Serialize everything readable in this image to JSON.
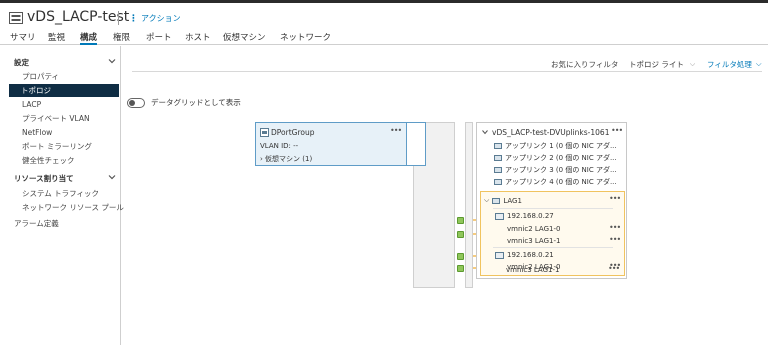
{
  "header": {
    "title": "vDS_LACP-test",
    "actions_label": "アクション",
    "icon": "distributed-switch-icon"
  },
  "tabs": [
    {
      "label": "サマリ",
      "active": false
    },
    {
      "label": "監視",
      "active": false
    },
    {
      "label": "構成",
      "active": true
    },
    {
      "label": "権限",
      "active": false
    },
    {
      "label": "ポート",
      "active": false
    },
    {
      "label": "ホスト",
      "active": false
    },
    {
      "label": "仮想マシン",
      "active": false
    },
    {
      "label": "ネットワーク",
      "active": false
    }
  ],
  "sidebar": {
    "section_settings": "設定",
    "settings_items": [
      {
        "label": "プロパティ",
        "active": false
      },
      {
        "label": "トポロジ",
        "active": true
      },
      {
        "label": "LACP",
        "active": false
      },
      {
        "label": "プライベート VLAN",
        "active": false
      },
      {
        "label": "NetFlow",
        "active": false
      },
      {
        "label": "ポート ミラーリング",
        "active": false
      },
      {
        "label": "健全性チェック",
        "active": false
      }
    ],
    "section_resources": "リソース割り当て",
    "resource_items": [
      {
        "label": "システム トラフィック"
      },
      {
        "label": "ネットワーク リソース プール"
      }
    ],
    "alarm_definitions": "アラーム定義"
  },
  "toolbar": {
    "favorite_filter": "お気に入りフィルタ",
    "view_select": "トポロジ ライト",
    "filter_action": "フィルタ処理"
  },
  "toggle": {
    "label": "データグリッドとして表示",
    "on": false
  },
  "portgroup": {
    "name": "DPortGroup",
    "vlan": "VLAN ID: --",
    "vms": "仮想マシン (1)"
  },
  "uplinks": {
    "title": "vDS_LACP-test-DVUplinks-1061",
    "items": [
      "アップリンク 1 (0 個の NIC アダ...",
      "アップリンク 2 (0 個の NIC アダ...",
      "アップリンク 3 (0 個の NIC アダ...",
      "アップリンク 4 (0 個の NIC アダ..."
    ],
    "lag": {
      "name": "LAG1",
      "hosts": [
        {
          "ip": "192.168.0.27",
          "ports": [
            "vmnic2 LAG1-0",
            "vmnic3 LAG1-1"
          ]
        },
        {
          "ip": "192.168.0.21",
          "ports": [
            "vmnic2 LAG1-0",
            "vmnic3 LAG1-1"
          ]
        }
      ]
    }
  },
  "colors": {
    "accent": "#0079b8",
    "active_nav": "#0f2d44",
    "link_line": "#f0a92a",
    "port_green": "#8fc65a"
  }
}
